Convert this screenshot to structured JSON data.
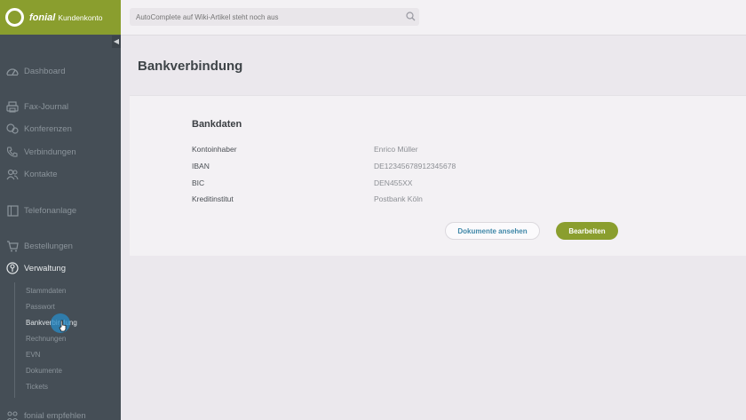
{
  "brand": {
    "name": "fonial",
    "subtitle": "Kundenkonto",
    "color": "#8a9e2e"
  },
  "search": {
    "placeholder": "AutoComplete auf Wiki-Artikel steht noch aus"
  },
  "sidebar": {
    "items": [
      {
        "label": "Dashboard",
        "icon": "dashboard-icon"
      },
      {
        "label": "Fax-Journal",
        "icon": "fax-icon"
      },
      {
        "label": "Konferenzen",
        "icon": "conference-icon"
      },
      {
        "label": "Verbindungen",
        "icon": "phone-icon"
      },
      {
        "label": "Kontakte",
        "icon": "contacts-icon"
      },
      {
        "label": "Telefonanlage",
        "icon": "building-icon"
      },
      {
        "label": "Bestellungen",
        "icon": "cart-icon"
      },
      {
        "label": "Verwaltung",
        "icon": "admin-icon",
        "active": true
      },
      {
        "label": "fonial empfehlen",
        "icon": "recommend-icon"
      }
    ],
    "subitems": [
      {
        "label": "Stammdaten"
      },
      {
        "label": "Passwort"
      },
      {
        "label": "Bankverbindung",
        "current": true
      },
      {
        "label": "Rechnungen"
      },
      {
        "label": "EVN"
      },
      {
        "label": "Dokumente"
      },
      {
        "label": "Tickets"
      }
    ]
  },
  "page": {
    "title": "Bankverbindung"
  },
  "bankdaten": {
    "title": "Bankdaten",
    "rows": [
      {
        "label": "Kontoinhaber",
        "value": "Enrico Müller"
      },
      {
        "label": "IBAN",
        "value": "DE12345678912345678"
      },
      {
        "label": "BIC",
        "value": "DEN455XX"
      },
      {
        "label": "Kreditinstitut",
        "value": "Postbank Köln"
      }
    ],
    "buttons": {
      "documents": "Dokumente ansehen",
      "edit": "Bearbeiten"
    }
  }
}
